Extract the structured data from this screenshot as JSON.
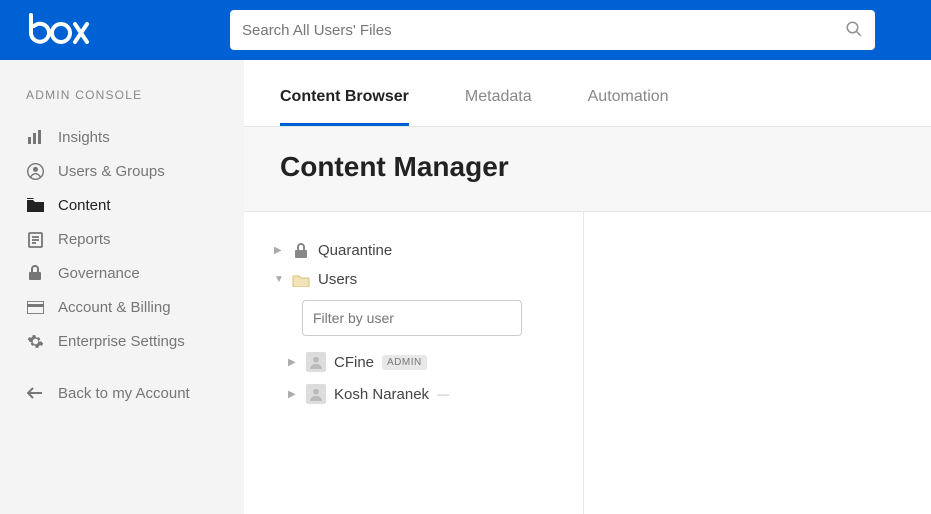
{
  "brand": "box",
  "search": {
    "placeholder": "Search All Users' Files"
  },
  "sidebar": {
    "heading": "ADMIN CONSOLE",
    "items": [
      {
        "label": "Insights"
      },
      {
        "label": "Users & Groups"
      },
      {
        "label": "Content"
      },
      {
        "label": "Reports"
      },
      {
        "label": "Governance"
      },
      {
        "label": "Account & Billing"
      },
      {
        "label": "Enterprise Settings"
      }
    ],
    "back": "Back to my Account"
  },
  "tabs": [
    {
      "label": "Content Browser"
    },
    {
      "label": "Metadata"
    },
    {
      "label": "Automation"
    }
  ],
  "page_title": "Content Manager",
  "tree": {
    "quarantine": "Quarantine",
    "users": "Users",
    "filter_placeholder": "Filter by user",
    "user1": {
      "name": "CFine",
      "badge": "ADMIN"
    },
    "user2": {
      "name": "Kosh Naranek"
    }
  }
}
